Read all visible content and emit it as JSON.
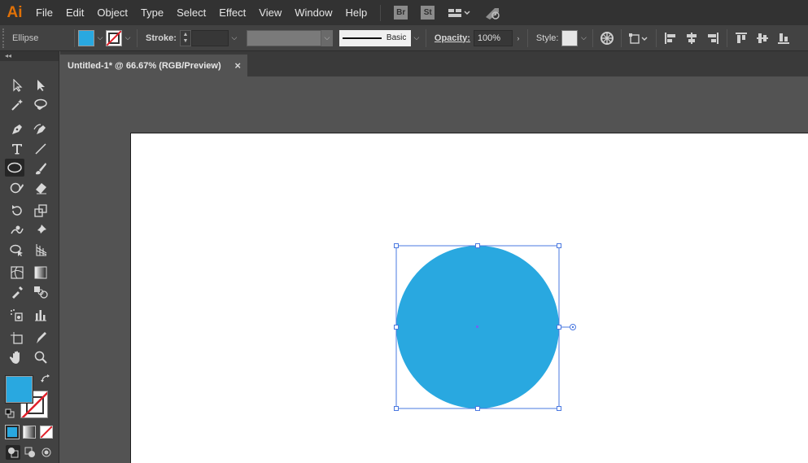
{
  "app": {
    "logo": "Ai"
  },
  "menu": [
    "File",
    "Edit",
    "Object",
    "Type",
    "Select",
    "Effect",
    "View",
    "Window",
    "Help"
  ],
  "app_badges": {
    "bridge": "Br",
    "stock": "St"
  },
  "control": {
    "shape_name": "Ellipse",
    "fill_color": "#29a8e0",
    "stroke_label": "Stroke:",
    "stroke_weight": "",
    "stroke_profile": "Basic",
    "opacity_label": "Opacity:",
    "opacity_value": "100%",
    "style_label": "Style:"
  },
  "document": {
    "tab_title": "Untitled-1* @ 66.67% (RGB/Preview)",
    "close_glyph": "×"
  },
  "tools": {
    "collapse_glyph": "◂◂",
    "active_tool": "ellipse-tool",
    "fill_color": "#29a8e0",
    "stroke": "none"
  },
  "canvas": {
    "shape": "ellipse",
    "fill_color": "#29a8e0",
    "selection_color": "#4a78e0"
  }
}
